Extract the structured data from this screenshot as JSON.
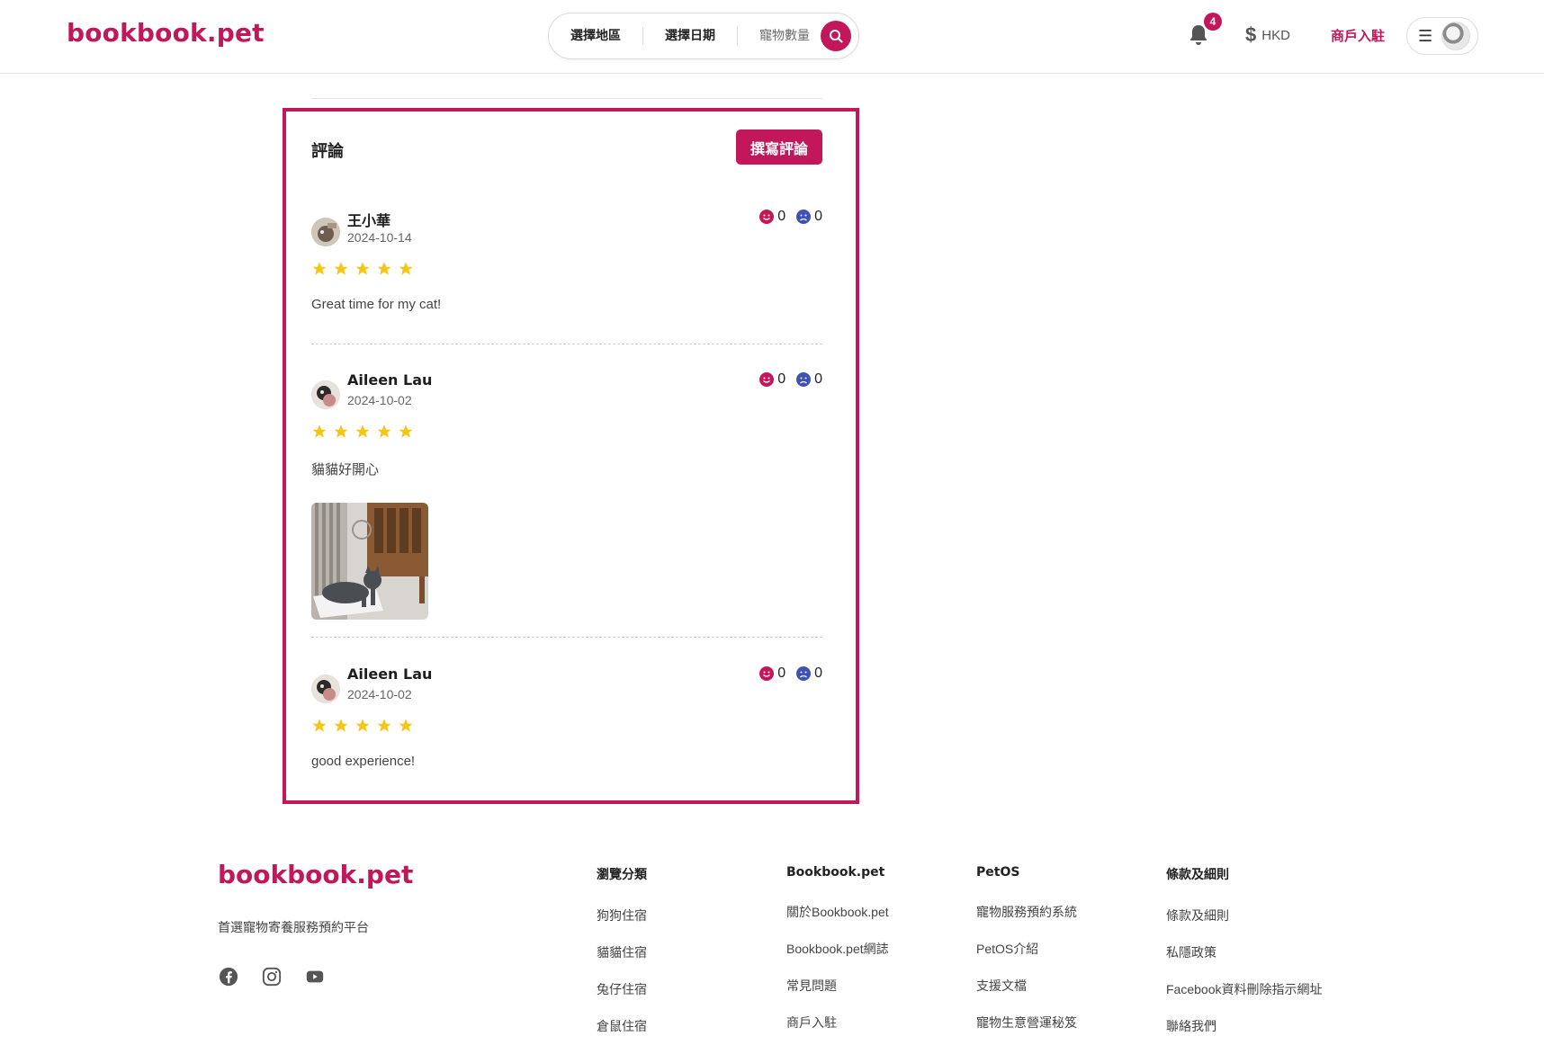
{
  "header": {
    "logo": "bookbook.pet",
    "search": {
      "region_label": "選擇地區",
      "date_label": "選擇日期",
      "pets_label": "寵物數量"
    },
    "notifications_count": "4",
    "currency": "HKD",
    "merchant_link": "商戶入駐"
  },
  "reviews": {
    "title": "評論",
    "write_button": "撰寫評論",
    "items": [
      {
        "name": "王小華",
        "date": "2024-10-14",
        "stars": 5,
        "likes": "0",
        "dislikes": "0",
        "text": "Great time for my cat!",
        "has_photo": false
      },
      {
        "name": "Aileen Lau",
        "date": "2024-10-02",
        "stars": 5,
        "likes": "0",
        "dislikes": "0",
        "text": "貓貓好開心",
        "has_photo": true
      },
      {
        "name": "Aileen Lau",
        "date": "2024-10-02",
        "stars": 5,
        "likes": "0",
        "dislikes": "0",
        "text": "good experience!",
        "has_photo": false
      }
    ]
  },
  "footer": {
    "logo": "bookbook.pet",
    "tagline": "首選寵物寄養服務預約平台",
    "social": [
      "facebook-icon",
      "instagram-icon",
      "youtube-icon"
    ],
    "columns": [
      {
        "title": "瀏覽分類",
        "links": [
          "狗狗住宿",
          "貓貓住宿",
          "兔仔住宿",
          "倉鼠住宿"
        ]
      },
      {
        "title": "Bookbook.pet",
        "links": [
          "關於Bookbook.pet",
          "Bookbook.pet網誌",
          "常見問題",
          "商戶入駐"
        ]
      },
      {
        "title": "PetOS",
        "links": [
          "寵物服務預約系統",
          "PetOS介紹",
          "支援文檔",
          "寵物生意營運秘笈"
        ]
      },
      {
        "title": "條款及細則",
        "links": [
          "條款及細則",
          "私隱政策",
          "Facebook資料刪除指示網址",
          "聯絡我們"
        ]
      }
    ]
  },
  "colors": {
    "brand": "#c2185b",
    "star": "#f5c518",
    "dislike": "#3f51b5"
  }
}
